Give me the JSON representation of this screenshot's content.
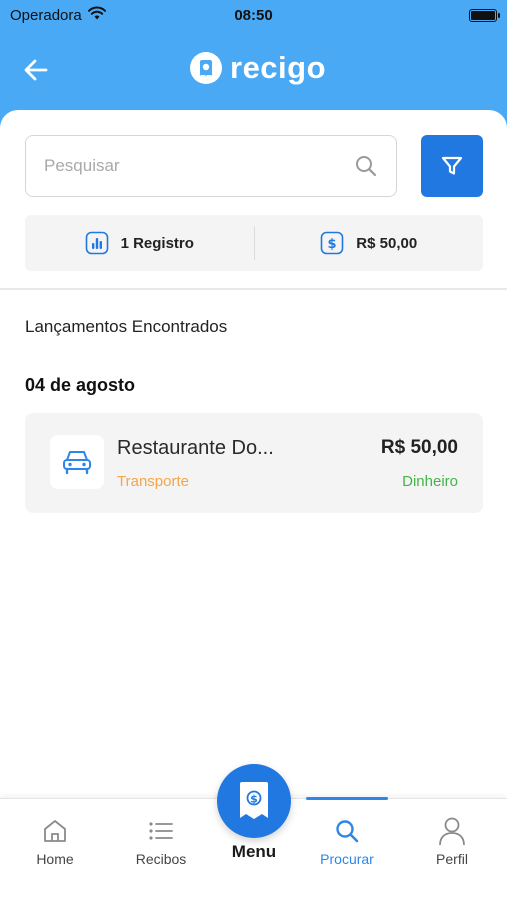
{
  "status_bar": {
    "carrier": "Operadora",
    "time": "08:50"
  },
  "header": {
    "brand": "recigo"
  },
  "search": {
    "placeholder": "Pesquisar",
    "value": ""
  },
  "summary": {
    "records": "1 Registro",
    "total": "R$ 50,00"
  },
  "section_title": "Lançamentos Encontrados",
  "groups": [
    {
      "date": "04 de agosto",
      "entries": [
        {
          "name": "Restaurante Do...",
          "category": "Transporte",
          "amount": "R$ 50,00",
          "payment_method": "Dinheiro",
          "icon": "car-icon"
        }
      ]
    }
  ],
  "tab_bar": {
    "items": [
      {
        "label": "Home",
        "icon": "home-icon",
        "active": false
      },
      {
        "label": "Recibos",
        "icon": "list-icon",
        "active": false
      },
      {
        "label": "Menu",
        "icon": "receipt-icon",
        "active": false
      },
      {
        "label": "Procurar",
        "icon": "search-icon",
        "active": true
      },
      {
        "label": "Perfil",
        "icon": "user-icon",
        "active": false
      }
    ]
  },
  "colors": {
    "header_bg": "#4aa9f5",
    "primary": "#2178e0",
    "category": "#f5a54a",
    "payment": "#45b34a",
    "active_tab": "#2e86e8"
  }
}
